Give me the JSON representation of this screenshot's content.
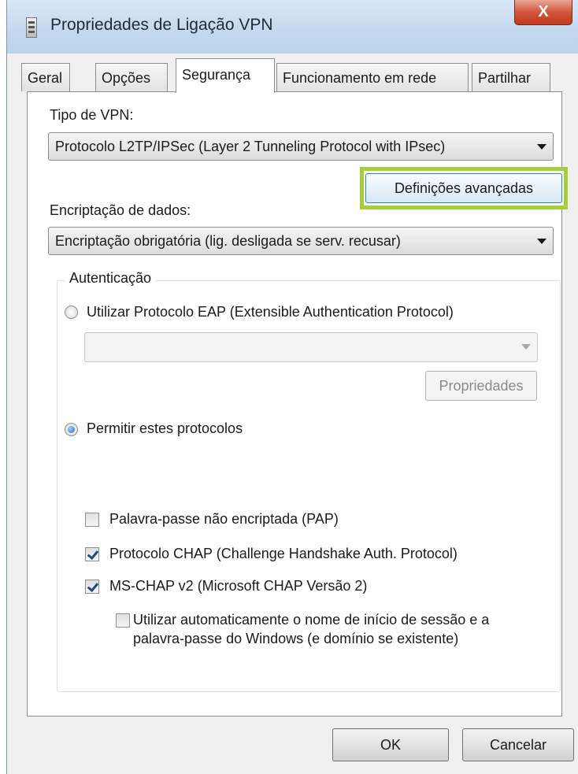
{
  "window": {
    "title": "Propriedades de Ligação VPN",
    "close_glyph": "X",
    "icon": "connection-properties-icon"
  },
  "tabs": [
    {
      "label": "Geral"
    },
    {
      "label": "Opções"
    },
    {
      "label": "Segurança",
      "selected": true
    },
    {
      "label": "Funcionamento em rede"
    },
    {
      "label": "Partilhar"
    }
  ],
  "security": {
    "vpn_type": {
      "label": "Tipo de VPN:",
      "value": "Protocolo L2TP/IPSec (Layer 2 Tunneling Protocol with IPsec)"
    },
    "advanced_button": "Definições avançadas",
    "encryption": {
      "label": "Encriptação de dados:",
      "value": "Encriptação obrigatória (lig. desligada se serv. recusar)"
    },
    "auth": {
      "group_title": "Autenticação",
      "eap_radio": {
        "label": "Utilizar Protocolo EAP (Extensible Authentication Protocol)",
        "checked": false
      },
      "eap_select_value": "",
      "properties_button": "Propriedades",
      "allow_radio": {
        "label": "Permitir estes protocolos",
        "checked": true
      },
      "protocols": [
        {
          "label": "Palavra-passe não encriptada (PAP)",
          "checked": false
        },
        {
          "label": "Protocolo CHAP (Challenge Handshake Auth. Protocol)",
          "checked": true
        },
        {
          "label": "MS-CHAP v2 (Microsoft CHAP Versão 2)",
          "checked": true
        }
      ],
      "auto_logon": {
        "label": "Utilizar automaticamente o nome de início de sessão e a palavra-passe do Windows (e domínio se existente)",
        "checked": false
      }
    }
  },
  "buttons": {
    "ok": "OK",
    "cancel": "Cancelar"
  },
  "colors": {
    "highlight": "#a4cf3a",
    "close_button": "#c2391d",
    "titlebar": "#c3d8ee"
  }
}
